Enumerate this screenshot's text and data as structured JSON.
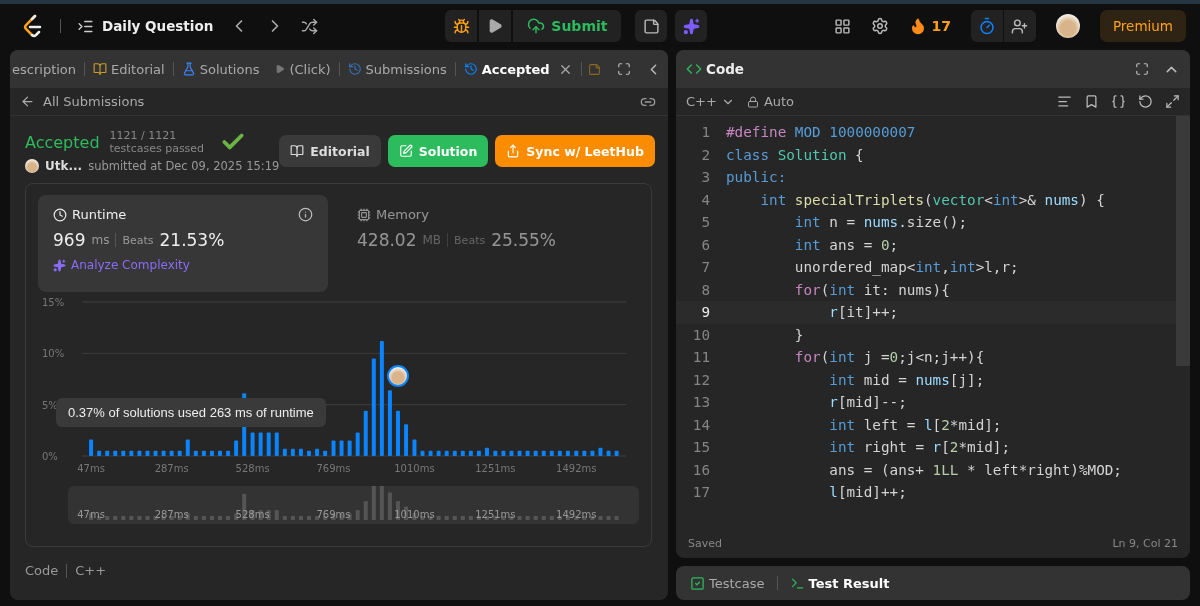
{
  "topbar": {
    "title": "Daily Question",
    "submit": "Submit",
    "streak": "17",
    "premium": "Premium"
  },
  "left_panel": {
    "tabs": [
      {
        "label": "escription",
        "selected": false,
        "closable": false
      },
      {
        "label": "Editorial",
        "selected": false,
        "closable": false
      },
      {
        "label": "Solutions",
        "selected": false,
        "closable": false
      },
      {
        "label": "(Click)",
        "selected": false,
        "closable": false
      },
      {
        "label": "Submissions",
        "selected": false,
        "closable": false
      },
      {
        "label": "Accepted",
        "selected": true,
        "closable": true
      }
    ],
    "back_link": "All Submissions",
    "result": {
      "status": "Accepted",
      "count": "1121 / 1121",
      "count_label": "testcases passed",
      "user": "Utk...",
      "submitted": "submitted at Dec 09, 2025 15:19"
    },
    "buttons": [
      "Editorial",
      "Solution",
      "Sync w/ LeetHub"
    ],
    "metrics": [
      {
        "label": "Runtime",
        "value": "969",
        "unit": "ms",
        "beats_label": "Beats",
        "beats": "21.53%",
        "selected": true,
        "link": "Analyze Complexity"
      },
      {
        "label": "Memory",
        "value": "428.02",
        "unit": "MB",
        "beats_label": "Beats",
        "beats": "25.55%",
        "selected": false
      }
    ],
    "chart_data": {
      "type": "bar",
      "x": [
        47,
        71,
        95,
        119,
        143,
        167,
        191,
        215,
        239,
        263,
        287,
        311,
        335,
        359,
        383,
        407,
        431,
        455,
        479,
        503,
        528,
        552,
        576,
        600,
        624,
        648,
        672,
        696,
        720,
        744,
        769,
        793,
        817,
        841,
        865,
        889,
        913,
        937,
        961,
        985,
        1010,
        1034,
        1058,
        1082,
        1106,
        1130,
        1154,
        1178,
        1202,
        1226,
        1251,
        1275,
        1299,
        1323,
        1347,
        1371,
        1395,
        1419,
        1443,
        1467,
        1492,
        1516,
        1540,
        1564,
        1588,
        1612
      ],
      "series": [
        {
          "color": "#0a84ff",
          "values": [
            1.6,
            0.5,
            0.5,
            0.5,
            0.5,
            0.5,
            0.5,
            0.5,
            0.5,
            0.5,
            0.5,
            0.5,
            1.6,
            0.5,
            0.5,
            0.5,
            0.5,
            0.5,
            1.5,
            6.1,
            2.3,
            2.3,
            2.3,
            2.3,
            0.7,
            0.7,
            0.7,
            0.5,
            0.7,
            0.5,
            1.5,
            1.5,
            1.5,
            2.3,
            4.4,
            9.5,
            11.2,
            6.4,
            4.4,
            3.1,
            1.6,
            0.5,
            0.5,
            0.5,
            0.5,
            0.5,
            0.5,
            0.5,
            0.5,
            0.8,
            0.5,
            0.5,
            0.5,
            0.5,
            0.5,
            0.5,
            0.5,
            0.5,
            0.5,
            0.5,
            0.5,
            0.5,
            0.5,
            0.8,
            0.5,
            0.5
          ]
        }
      ],
      "xticks": [
        {
          "value": 47,
          "label": "47ms"
        },
        {
          "value": 287,
          "label": "287ms"
        },
        {
          "value": 528,
          "label": "528ms"
        },
        {
          "value": 769,
          "label": "769ms"
        },
        {
          "value": 1010,
          "label": "1010ms"
        },
        {
          "value": 1251,
          "label": "1251ms"
        },
        {
          "value": 1492,
          "label": "1492ms"
        }
      ],
      "yticks": [
        {
          "value": 0,
          "label": "0%"
        },
        {
          "value": 5,
          "label": "5%"
        },
        {
          "value": 10,
          "label": "10%"
        },
        {
          "value": 15,
          "label": "15%"
        }
      ],
      "xlim": [
        20,
        1640
      ],
      "ylim": [
        0,
        15
      ]
    },
    "tooltip": "0.37% of solutions used 263 ms of runtime",
    "overview_labels": [
      "47ms",
      "287ms",
      "528ms",
      "769ms",
      "1010ms",
      "1251ms",
      "1492ms"
    ],
    "footer": [
      "Code",
      "C++"
    ]
  },
  "code_panel": {
    "title": "Code",
    "language": "C++",
    "mode": "Auto",
    "lines": [
      {
        "number": "1",
        "current": false,
        "tokens": [
          {
            "text": "#define",
            "kind": "kw"
          },
          {
            "text": " MOD 1000000007",
            "kind": "type"
          }
        ]
      },
      {
        "number": "2",
        "current": false,
        "tokens": [
          {
            "text": "class",
            "kind": "type"
          },
          {
            "text": " Solution",
            "kind": "cls"
          },
          {
            "text": " {",
            "kind": "plain"
          }
        ]
      },
      {
        "number": "3",
        "current": false,
        "tokens": [
          {
            "text": "public:",
            "kind": "type"
          }
        ]
      },
      {
        "number": "4",
        "current": false,
        "tokens": [
          {
            "text": "    int",
            "kind": "type"
          },
          {
            "text": " specialTriplets",
            "kind": "fn"
          },
          {
            "text": "(",
            "kind": "plain"
          },
          {
            "text": "vector",
            "kind": "cls"
          },
          {
            "text": "<",
            "kind": "plain"
          },
          {
            "text": "int",
            "kind": "type"
          },
          {
            "text": ">&",
            "kind": "plain"
          },
          {
            "text": " nums",
            "kind": "var"
          },
          {
            "text": ") {",
            "kind": "plain"
          }
        ]
      },
      {
        "number": "5",
        "current": false,
        "tokens": [
          {
            "text": "        int",
            "kind": "type"
          },
          {
            "text": " n = ",
            "kind": "plain"
          },
          {
            "text": "nums",
            "kind": "var"
          },
          {
            "text": ".size();",
            "kind": "plain"
          }
        ]
      },
      {
        "number": "6",
        "current": false,
        "tokens": [
          {
            "text": "        int",
            "kind": "type"
          },
          {
            "text": " ans = ",
            "kind": "plain"
          },
          {
            "text": "0",
            "kind": "num"
          },
          {
            "text": ";",
            "kind": "plain"
          }
        ]
      },
      {
        "number": "7",
        "current": false,
        "tokens": [
          {
            "text": "        unordered_map<",
            "kind": "plain"
          },
          {
            "text": "int",
            "kind": "type"
          },
          {
            "text": ",",
            "kind": "plain"
          },
          {
            "text": "int",
            "kind": "type"
          },
          {
            "text": ">l,r;",
            "kind": "plain"
          }
        ]
      },
      {
        "number": "8",
        "current": false,
        "tokens": [
          {
            "text": "        for",
            "kind": "kw"
          },
          {
            "text": "(",
            "kind": "plain"
          },
          {
            "text": "int",
            "kind": "type"
          },
          {
            "text": " it: nums){",
            "kind": "plain"
          }
        ]
      },
      {
        "number": "9",
        "current": true,
        "tokens": [
          {
            "text": "            r",
            "kind": "var"
          },
          {
            "text": "[it]++;",
            "kind": "plain"
          }
        ]
      },
      {
        "number": "10",
        "current": false,
        "tokens": [
          {
            "text": "        }",
            "kind": "plain"
          }
        ]
      },
      {
        "number": "11",
        "current": false,
        "tokens": [
          {
            "text": "        for",
            "kind": "kw"
          },
          {
            "text": "(",
            "kind": "plain"
          },
          {
            "text": "int",
            "kind": "type"
          },
          {
            "text": " j =",
            "kind": "plain"
          },
          {
            "text": "0",
            "kind": "num"
          },
          {
            "text": ";j<n;j++){",
            "kind": "plain"
          }
        ]
      },
      {
        "number": "12",
        "current": false,
        "tokens": [
          {
            "text": "            int",
            "kind": "type"
          },
          {
            "text": " mid = ",
            "kind": "plain"
          },
          {
            "text": "nums",
            "kind": "var"
          },
          {
            "text": "[j];",
            "kind": "plain"
          }
        ]
      },
      {
        "number": "13",
        "current": false,
        "tokens": [
          {
            "text": "            r",
            "kind": "var"
          },
          {
            "text": "[mid]--;",
            "kind": "plain"
          }
        ]
      },
      {
        "number": "14",
        "current": false,
        "tokens": [
          {
            "text": "            int",
            "kind": "type"
          },
          {
            "text": " left = ",
            "kind": "plain"
          },
          {
            "text": "l",
            "kind": "var"
          },
          {
            "text": "[",
            "kind": "plain"
          },
          {
            "text": "2",
            "kind": "num"
          },
          {
            "text": "*mid];",
            "kind": "plain"
          }
        ]
      },
      {
        "number": "15",
        "current": false,
        "tokens": [
          {
            "text": "            int",
            "kind": "type"
          },
          {
            "text": " right = ",
            "kind": "plain"
          },
          {
            "text": "r",
            "kind": "var"
          },
          {
            "text": "[",
            "kind": "plain"
          },
          {
            "text": "2",
            "kind": "num"
          },
          {
            "text": "*mid];",
            "kind": "plain"
          }
        ]
      },
      {
        "number": "16",
        "current": false,
        "tokens": [
          {
            "text": "            ans = (ans+ ",
            "kind": "plain"
          },
          {
            "text": "1LL",
            "kind": "num"
          },
          {
            "text": " * left*right)%MOD;",
            "kind": "plain"
          }
        ]
      },
      {
        "number": "17",
        "current": false,
        "tokens": [
          {
            "text": "            l",
            "kind": "var"
          },
          {
            "text": "[mid]++;",
            "kind": "plain"
          }
        ]
      }
    ],
    "status": "Saved",
    "cursor": "Ln 9, Col 21"
  },
  "bottom_panel": {
    "tabs": [
      {
        "label": "Testcase",
        "selected": false
      },
      {
        "label": "Test Result",
        "selected": true
      }
    ]
  }
}
